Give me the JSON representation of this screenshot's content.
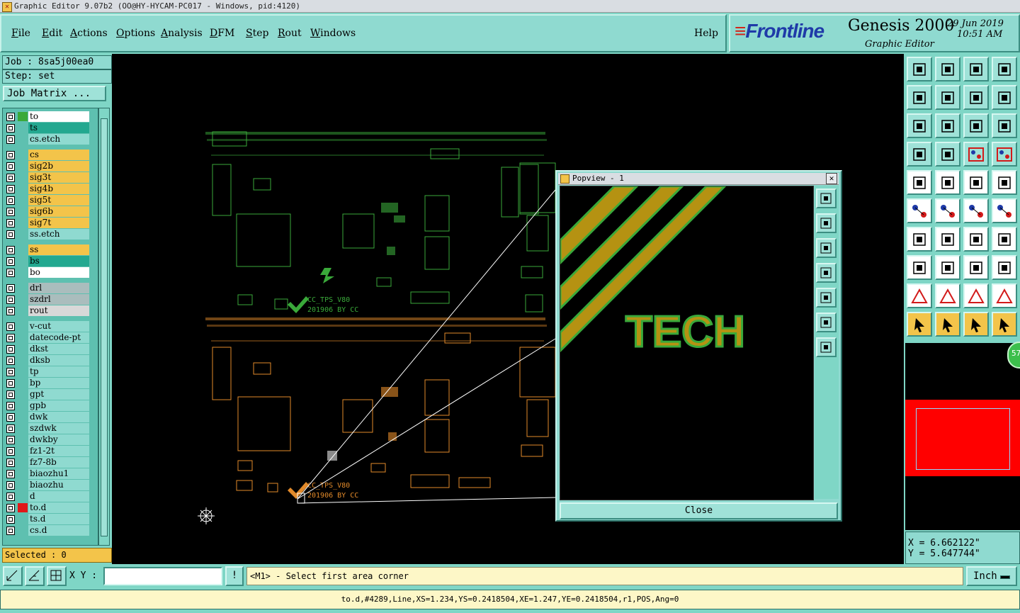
{
  "window": {
    "title": "Graphic Editor 9.07b2 (OO@HY-HYCAM-PC017 - Windows, pid:4120)"
  },
  "menu": {
    "items": [
      {
        "label": "File",
        "u": "F",
        "rest": "ile"
      },
      {
        "label": "Edit",
        "u": "E",
        "rest": "dit"
      },
      {
        "label": "Actions",
        "u": "A",
        "rest": "ctions"
      },
      {
        "label": "Options",
        "u": "O",
        "rest": "ptions"
      },
      {
        "label": "Analysis",
        "u": "A",
        "rest": "nalysis"
      },
      {
        "label": "DFM",
        "u": "D",
        "rest": "FM"
      },
      {
        "label": "Step",
        "u": "S",
        "rest": "tep"
      },
      {
        "label": "Rout",
        "u": "R",
        "rest": "out"
      },
      {
        "label": "Windows",
        "u": "W",
        "rest": "indows"
      }
    ],
    "help": "Help"
  },
  "branding": {
    "logo": "Frontline",
    "product": "Genesis 2000",
    "subtitle": "Graphic Editor",
    "date": "29 Jun 2019",
    "time": "10:51 AM"
  },
  "left_panel": {
    "job": "Job : 8sa5j00ea0",
    "step": "Step: set",
    "job_matrix": "Job Matrix ...",
    "selected": "Selected : 0",
    "layers": [
      {
        "name": "to",
        "color": "#ffffff",
        "swatch": "#3aa93a"
      },
      {
        "name": "ts",
        "color": "#23a890",
        "swatch": ""
      },
      {
        "name": "cs.etch",
        "color": "#8fdad0",
        "swatch": ""
      },
      {
        "name": "cs",
        "color": "#f3c44a",
        "swatch": ""
      },
      {
        "name": "sig2b",
        "color": "#f3c44a",
        "swatch": ""
      },
      {
        "name": "sig3t",
        "color": "#f3c44a",
        "swatch": ""
      },
      {
        "name": "sig4b",
        "color": "#f3c44a",
        "swatch": ""
      },
      {
        "name": "sig5t",
        "color": "#f3c44a",
        "swatch": ""
      },
      {
        "name": "sig6b",
        "color": "#f3c44a",
        "swatch": ""
      },
      {
        "name": "sig7t",
        "color": "#f3c44a",
        "swatch": ""
      },
      {
        "name": "ss.etch",
        "color": "#8fdad0",
        "swatch": ""
      },
      {
        "name": "ss",
        "color": "#f3c44a",
        "swatch": ""
      },
      {
        "name": "bs",
        "color": "#23a890",
        "swatch": ""
      },
      {
        "name": "bo",
        "color": "#ffffff",
        "swatch": ""
      },
      {
        "name": "drl",
        "color": "#aabdbd",
        "swatch": ""
      },
      {
        "name": "szdrl",
        "color": "#aabdbd",
        "swatch": ""
      },
      {
        "name": "rout",
        "color": "#d8d8d8",
        "swatch": ""
      },
      {
        "name": "v-cut",
        "color": "#8fdad0",
        "swatch": ""
      },
      {
        "name": "datecode-pt",
        "color": "#8fdad0",
        "swatch": ""
      },
      {
        "name": "dkst",
        "color": "#8fdad0",
        "swatch": ""
      },
      {
        "name": "dksb",
        "color": "#8fdad0",
        "swatch": ""
      },
      {
        "name": "tp",
        "color": "#8fdad0",
        "swatch": ""
      },
      {
        "name": "bp",
        "color": "#8fdad0",
        "swatch": ""
      },
      {
        "name": "gpt",
        "color": "#8fdad0",
        "swatch": ""
      },
      {
        "name": "gpb",
        "color": "#8fdad0",
        "swatch": ""
      },
      {
        "name": "dwk",
        "color": "#8fdad0",
        "swatch": ""
      },
      {
        "name": "szdwk",
        "color": "#8fdad0",
        "swatch": ""
      },
      {
        "name": "dwkby",
        "color": "#8fdad0",
        "swatch": ""
      },
      {
        "name": "fz1-2t",
        "color": "#8fdad0",
        "swatch": ""
      },
      {
        "name": "fz7-8b",
        "color": "#8fdad0",
        "swatch": ""
      },
      {
        "name": "biaozhu1",
        "color": "#8fdad0",
        "swatch": ""
      },
      {
        "name": "biaozhu",
        "color": "#8fdad0",
        "swatch": ""
      },
      {
        "name": "d",
        "color": "#8fdad0",
        "swatch": ""
      },
      {
        "name": "to.d",
        "color": "#8fdad0",
        "swatch": "#e01818"
      },
      {
        "name": "ts.d",
        "color": "#8fdad0",
        "swatch": ""
      },
      {
        "name": "cs.d",
        "color": "#8fdad0",
        "swatch": ""
      }
    ]
  },
  "canvas": {
    "labels": [
      "CC_TPS_V80",
      "201906 BY CC"
    ]
  },
  "popview": {
    "title": "Popview - 1",
    "text": "TECH",
    "close": "Close"
  },
  "toolbox": {
    "badge": "57"
  },
  "coords": {
    "x": "X = 6.662122\"",
    "y": "Y = 5.647744\""
  },
  "bottom": {
    "xy_label": "X Y :",
    "xy_value": "",
    "prompt": "<M1> - Select first area corner",
    "unit": "Inch",
    "alert": "!"
  },
  "status": {
    "text": "to.d,#4289,Line,XS=1.234,YS=0.2418504,XE=1.247,YE=0.2418504,r1,POS,Ang=0"
  },
  "colors": {
    "panel": "#7fd6c6",
    "copper": "#f3c44a",
    "green": "#3aa93a",
    "canvas": "#000000"
  }
}
